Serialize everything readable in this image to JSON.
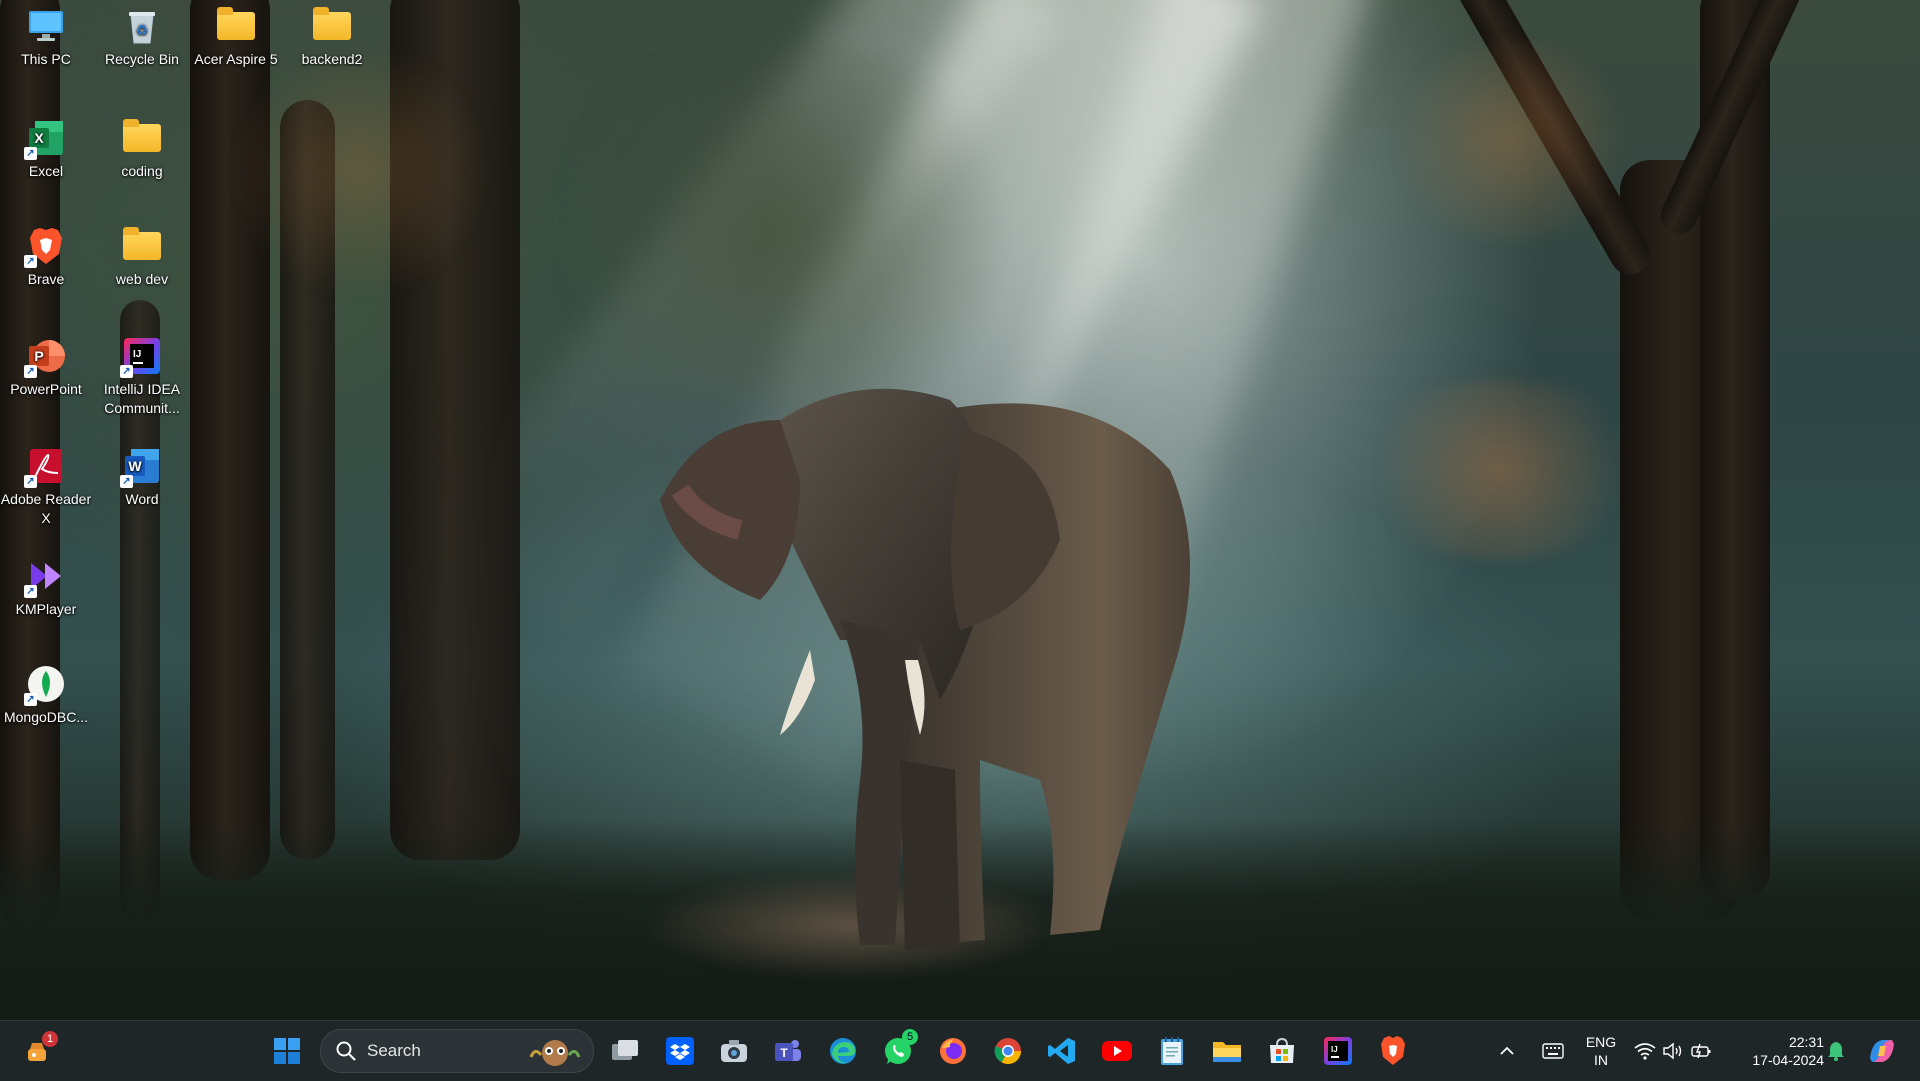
{
  "desktop_icons": [
    {
      "label": "This PC",
      "icon": "monitor-icon"
    },
    {
      "label": "Recycle Bin",
      "icon": "recycle-bin-icon"
    },
    {
      "label": "Acer Aspire 5",
      "icon": "folder-icon"
    },
    {
      "label": "backend2",
      "icon": "folder-icon"
    },
    {
      "label": "Excel",
      "icon": "excel-icon"
    },
    {
      "label": "coding",
      "icon": "folder-icon"
    },
    {
      "label": "Brave",
      "icon": "brave-icon"
    },
    {
      "label": "web dev",
      "icon": "folder-icon"
    },
    {
      "label": "PowerPoint",
      "icon": "powerpoint-icon"
    },
    {
      "label": "IntelliJ IDEA Communit...",
      "icon": "intellij-icon"
    },
    {
      "label": "Adobe Reader X",
      "icon": "adobe-reader-icon"
    },
    {
      "label": "Word",
      "icon": "word-icon"
    },
    {
      "label": "KMPlayer",
      "icon": "kmplayer-icon"
    },
    {
      "label": "MongoDBC...",
      "icon": "mongodb-icon"
    }
  ],
  "taskbar": {
    "widgets_badge": "1",
    "search_placeholder": "Search",
    "whatsapp_badge": "5",
    "apps": [
      "task-view",
      "dropbox",
      "camera",
      "teams",
      "edge",
      "whatsapp",
      "firefox",
      "chrome",
      "vscode",
      "youtube",
      "notepad",
      "file-explorer",
      "microsoft-store",
      "intellij",
      "brave"
    ],
    "language_line1": "ENG",
    "language_line2": "IN",
    "time": "22:31",
    "date": "17-04-2024"
  },
  "colors": {
    "taskbar_bg": "#202628",
    "windows_blue": "#0078d4"
  }
}
